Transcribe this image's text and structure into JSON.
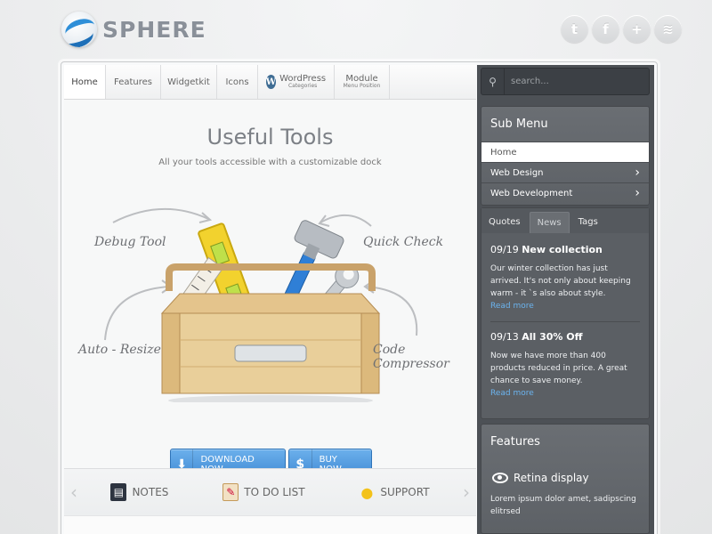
{
  "brand": {
    "name": "SPHERE"
  },
  "social": [
    {
      "icon": "twitter-icon",
      "glyph": "t"
    },
    {
      "icon": "facebook-icon",
      "glyph": "f"
    },
    {
      "icon": "plus-icon",
      "glyph": "+"
    },
    {
      "icon": "rss-icon",
      "glyph": "≋"
    }
  ],
  "nav": {
    "home": "Home",
    "features": "Features",
    "widgetkit": "Widgetkit",
    "icons": "Icons",
    "wordpress": "WordPress",
    "wordpress_sub": "Categories",
    "module": "Module",
    "module_sub": "Menu Position"
  },
  "hero": {
    "title": "Useful Tools",
    "subtitle": "All your tools accessible with a customizable dock",
    "labels": {
      "debug": "Debug Tool",
      "quick": "Quick Check",
      "resize": "Auto - Resize",
      "compress": "Code Compressor"
    },
    "download": "DOWNLOAD NOW",
    "buy": "BUY NOW"
  },
  "feature_bar": {
    "notes": "NOTES",
    "todo": "TO DO LIST",
    "support": "SUPPORT"
  },
  "search": {
    "placeholder": "search..."
  },
  "submenu": {
    "title": "Sub Menu",
    "items": [
      "Home",
      "Web Design",
      "Web Development"
    ]
  },
  "tabs": [
    "Quotes",
    "News",
    "Tags"
  ],
  "news": [
    {
      "date": "09/19",
      "title": "New collection",
      "body": "Our winter collection has just arrived. It's not only about keeping warm - it `s also about style.",
      "more": "Read more"
    },
    {
      "date": "09/13",
      "title": "All 30% Off",
      "body": "Now we have more than 400 products reduced in price. A great chance to save money.",
      "more": "Read more"
    }
  ],
  "features_panel": {
    "title": "Features",
    "item": "Retina display",
    "body": "Lorem ipsum dolor amet, sadipscing elitrsed"
  },
  "colors": {
    "accent": "#3d88d2",
    "sidebar": "#4d5156",
    "link": "#6bb3ee"
  }
}
